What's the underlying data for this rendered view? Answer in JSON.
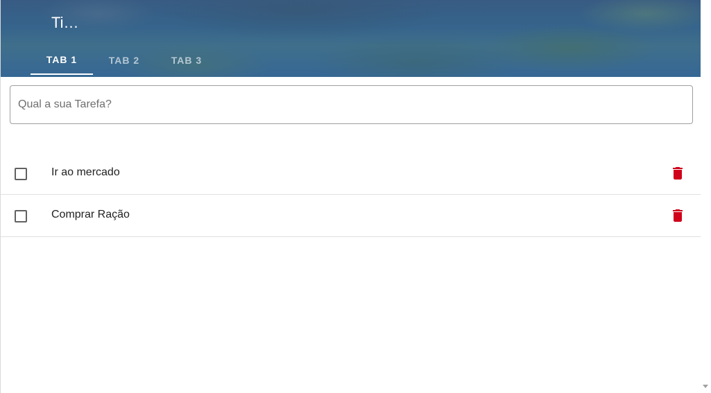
{
  "header": {
    "title": "Ti…",
    "tabs": [
      {
        "label": "TAB 1",
        "active": true
      },
      {
        "label": "TAB 2",
        "active": false
      },
      {
        "label": "TAB 3",
        "active": false
      }
    ]
  },
  "task_input": {
    "placeholder": "Qual a sua Tarefa?",
    "value": ""
  },
  "tasks": [
    {
      "label": "Ir ao mercado",
      "checked": false,
      "delete_icon": "trash-icon"
    },
    {
      "label": "Comprar Ração",
      "checked": false,
      "delete_icon": "trash-icon"
    }
  ],
  "colors": {
    "accent": "#ffffff",
    "delete": "#d0021b",
    "checkbox_border": "#616161"
  }
}
